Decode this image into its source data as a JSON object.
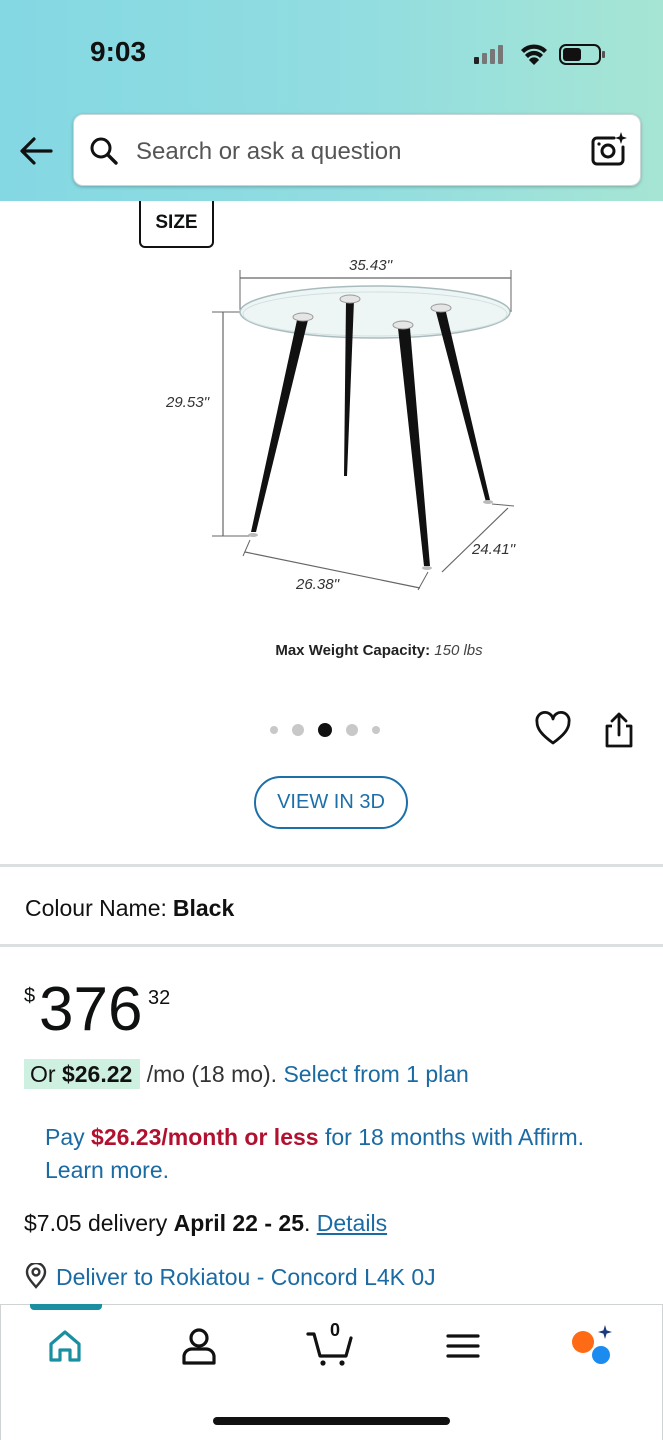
{
  "status_bar": {
    "time": "9:03"
  },
  "search": {
    "placeholder": "Search or ask a question"
  },
  "icons": {
    "back": "arrow-left-icon",
    "search": "search-icon",
    "camera": "camera-sparkle-icon",
    "heart": "heart-icon",
    "share": "share-icon",
    "pin": "location-pin-icon",
    "home": "home-icon",
    "account": "account-icon",
    "cart": "cart-icon",
    "menu": "menu-icon",
    "assistant": "assistant-icon"
  },
  "product_image": {
    "size_tag": "SIZE",
    "dim_top": "35.43''",
    "dim_height": "29.53''",
    "dim_depth": "24.41''",
    "dim_bottom": "26.38''",
    "max_weight_label": "Max Weight Capacity:",
    "max_weight_value": "150 lbs"
  },
  "carousel": {
    "total": 5,
    "active_index": 2
  },
  "view_3d": "VIEW IN 3D",
  "colour": {
    "label": "Colour Name:",
    "value": "Black"
  },
  "price": {
    "symbol": "$",
    "whole": "376",
    "fraction": "32"
  },
  "monthly": {
    "or_prefix": "Or",
    "amount": "$26.22",
    "suffix": " /mo (18 mo). ",
    "plan_link": "Select from 1 plan"
  },
  "affirm": {
    "pre": "Pay ",
    "amount": "$26.23/month or less",
    "post": " for 18 months with Affirm. Learn more."
  },
  "delivery": {
    "cost": "$7.05 delivery ",
    "dates": "April 22 - 25",
    "sep": ". ",
    "details": "Details"
  },
  "deliver_to": "Deliver to Rokiatou - Concord L4K 0J",
  "bottom_nav": {
    "cart_count": "0"
  },
  "colors": {
    "link": "#1a6aa3",
    "price_red": "#b2102f",
    "nav_accent": "#1a8fa0",
    "header_gradient_start": "#84d8e3",
    "header_gradient_end": "#a6e5d4"
  }
}
